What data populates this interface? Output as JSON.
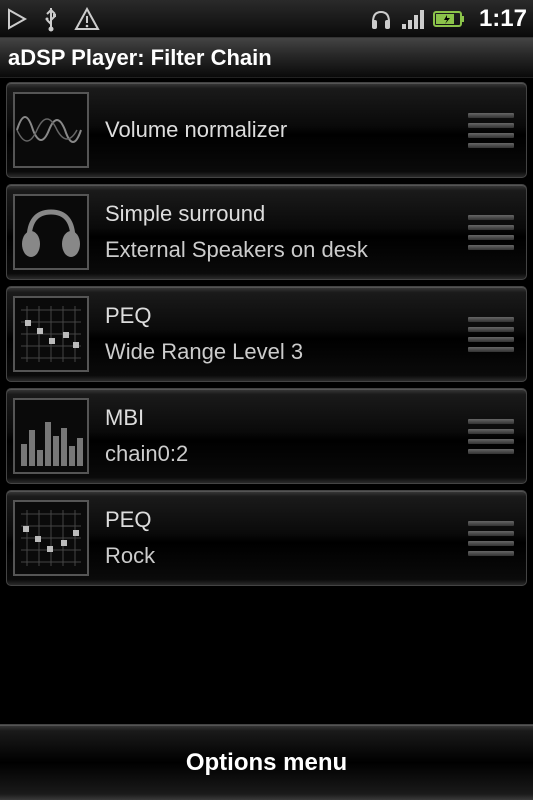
{
  "status": {
    "clock": "1:17"
  },
  "title": "aDSP Player: Filter Chain",
  "filters": [
    {
      "name": "Volume normalizer",
      "sub": "",
      "icon": "waveform"
    },
    {
      "name": "Simple surround",
      "sub": "External Speakers on desk",
      "icon": "headphones"
    },
    {
      "name": "PEQ",
      "sub": "Wide Range Level 3",
      "icon": "peq"
    },
    {
      "name": "MBI",
      "sub": "chain0:2",
      "icon": "bars"
    },
    {
      "name": "PEQ",
      "sub": "Rock",
      "icon": "peq"
    }
  ],
  "options_label": "Options menu"
}
